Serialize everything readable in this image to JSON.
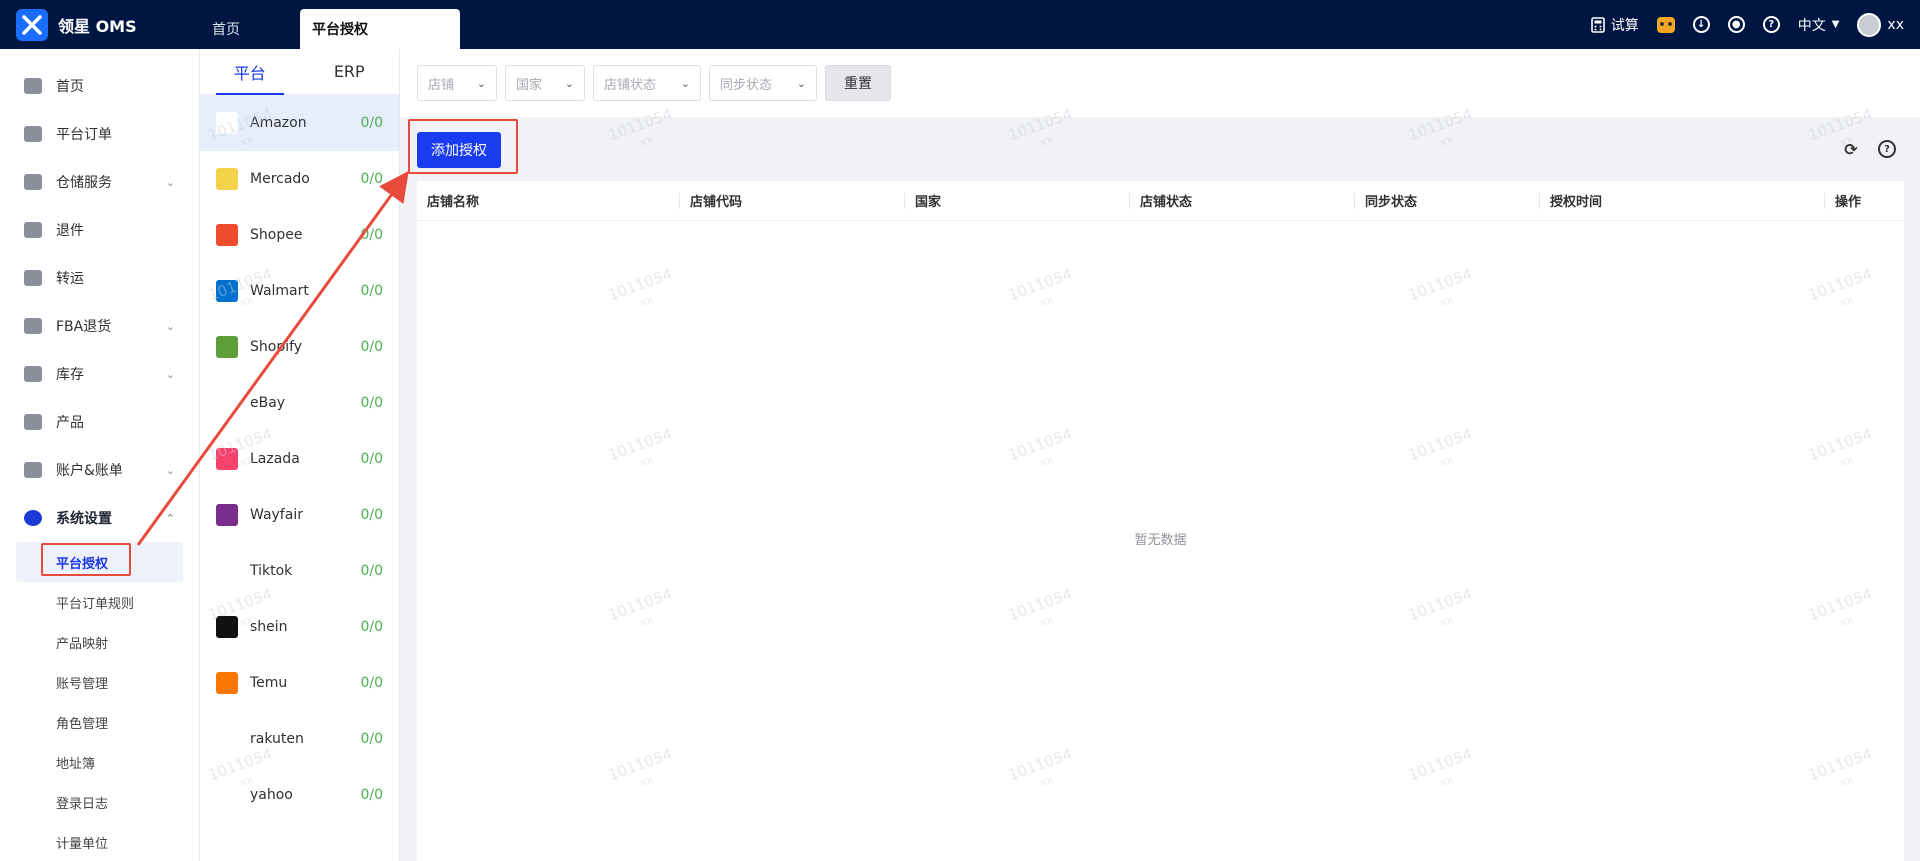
{
  "app": {
    "name": "领星 OMS"
  },
  "tabs": [
    {
      "label": "首页"
    },
    {
      "label": "平台授权"
    }
  ],
  "topbar": {
    "calc_label": "试算",
    "lang": "中文",
    "user": "xx"
  },
  "sidebar": {
    "items": [
      {
        "label": "首页"
      },
      {
        "label": "平台订单"
      },
      {
        "label": "仓储服务"
      },
      {
        "label": "退件"
      },
      {
        "label": "转运"
      },
      {
        "label": "FBA退货"
      },
      {
        "label": "库存"
      },
      {
        "label": "产品"
      },
      {
        "label": "账户&账单"
      },
      {
        "label": "系统设置"
      }
    ],
    "sub_items": [
      {
        "label": "平台授权"
      },
      {
        "label": "平台订单规则"
      },
      {
        "label": "产品映射"
      },
      {
        "label": "账号管理"
      },
      {
        "label": "角色管理"
      },
      {
        "label": "地址簿"
      },
      {
        "label": "登录日志"
      },
      {
        "label": "计量单位"
      }
    ]
  },
  "platform_panel": {
    "tabs": [
      {
        "label": "平台"
      },
      {
        "label": "ERP"
      }
    ],
    "items": [
      {
        "name": "Amazon",
        "count": "0/0",
        "icon": "amazon-icon",
        "color": "#ffffff"
      },
      {
        "name": "Mercado",
        "count": "0/0",
        "icon": "mercado-icon",
        "color": "#f3d34a"
      },
      {
        "name": "Shopee",
        "count": "0/0",
        "icon": "shopee-icon",
        "color": "#ee4d2d"
      },
      {
        "name": "Walmart",
        "count": "0/0",
        "icon": "walmart-icon",
        "color": "#0071ce"
      },
      {
        "name": "Shopify",
        "count": "0/0",
        "icon": "shopify-icon",
        "color": "#5e9e3a"
      },
      {
        "name": "eBay",
        "count": "0/0",
        "icon": "ebay-icon",
        "color": "#ffffff"
      },
      {
        "name": "Lazada",
        "count": "0/0",
        "icon": "lazada-icon",
        "color": "#f5436c"
      },
      {
        "name": "Wayfair",
        "count": "0/0",
        "icon": "wayfair-icon",
        "color": "#7b2d8e"
      },
      {
        "name": "Tiktok",
        "count": "0/0",
        "icon": "tiktok-icon",
        "color": "#ffffff"
      },
      {
        "name": "shein",
        "count": "0/0",
        "icon": "shein-icon",
        "color": "#111111"
      },
      {
        "name": "Temu",
        "count": "0/0",
        "icon": "temu-icon",
        "color": "#fb7701"
      },
      {
        "name": "rakuten",
        "count": "0/0",
        "icon": "rakuten-icon",
        "color": "#ffffff"
      },
      {
        "name": "yahoo",
        "count": "0/0",
        "icon": "yahoo-icon",
        "color": "#ffffff"
      }
    ]
  },
  "filters": {
    "shop": "店铺",
    "country": "国家",
    "shop_status": "店铺状态",
    "sync_status": "同步状态",
    "reset_label": "重置"
  },
  "actions": {
    "add_label": "添加授权"
  },
  "table": {
    "columns": [
      "店铺名称",
      "店铺代码",
      "国家",
      "店铺状态",
      "同步状态",
      "授权时间",
      "操作"
    ],
    "empty_text": "暂无数据"
  },
  "watermark": {
    "line1": "1011054",
    "line2": "xx"
  },
  "colors": {
    "primary": "#1a3cf0",
    "topbar": "#001642",
    "highlight": "#e84a3c",
    "count": "#4caf50"
  }
}
